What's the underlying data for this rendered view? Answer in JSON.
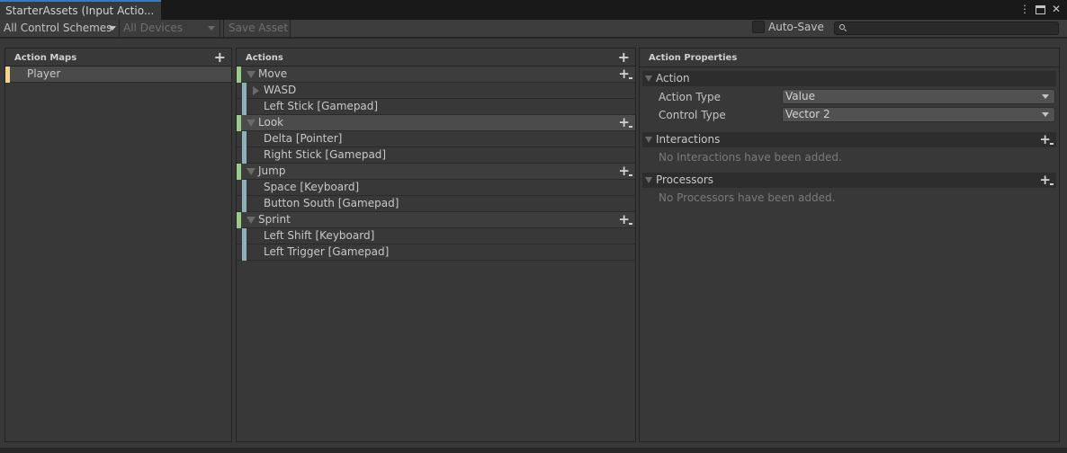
{
  "window": {
    "tab_title": "StarterAssets (Input Actio...",
    "icons": [
      "more-options-icon",
      "maximize-icon",
      "close-icon"
    ]
  },
  "toolbar": {
    "control_scheme": "All Control Schemes",
    "devices": "All Devices",
    "save_asset": "Save Asset",
    "auto_save_label": "Auto-Save",
    "auto_save_checked": false,
    "search_placeholder": ""
  },
  "action_maps": {
    "header": "Action Maps",
    "items": [
      {
        "label": "Player",
        "selected": true
      }
    ]
  },
  "actions": {
    "header": "Actions",
    "items": [
      {
        "label": "Move",
        "selected": false,
        "bindings": [
          {
            "label": "WASD",
            "composite": true
          },
          {
            "label": "Left Stick [Gamepad]"
          }
        ]
      },
      {
        "label": "Look",
        "selected": true,
        "bindings": [
          {
            "label": "Delta [Pointer]"
          },
          {
            "label": "Right Stick [Gamepad]"
          }
        ]
      },
      {
        "label": "Jump",
        "selected": false,
        "bindings": [
          {
            "label": "Space [Keyboard]"
          },
          {
            "label": "Button South [Gamepad]"
          }
        ]
      },
      {
        "label": "Sprint",
        "selected": false,
        "bindings": [
          {
            "label": "Left Shift [Keyboard]"
          },
          {
            "label": "Left Trigger [Gamepad]"
          }
        ]
      }
    ]
  },
  "properties": {
    "header": "Action Properties",
    "action_section": "Action",
    "action_type_label": "Action Type",
    "action_type_value": "Value",
    "control_type_label": "Control Type",
    "control_type_value": "Vector 2",
    "interactions_section": "Interactions",
    "interactions_empty": "No Interactions have been added.",
    "processors_section": "Processors",
    "processors_empty": "No Processors have been added."
  },
  "colors": {
    "tab_accent": "#3a79bb",
    "action_map_bar": "#f4d78c",
    "action_bar": "#9bc98e",
    "binding_bar": "#8eb0b9"
  }
}
